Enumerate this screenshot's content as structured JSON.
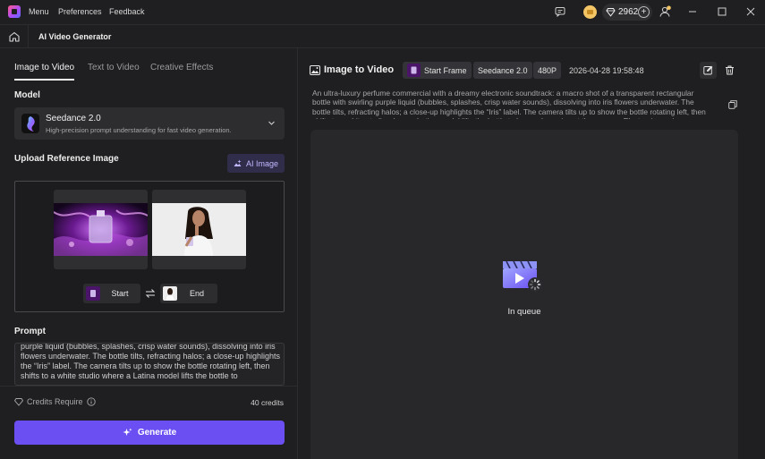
{
  "titlebar": {
    "menu": [
      "Menu",
      "Preferences",
      "Feedback"
    ],
    "credits": "2962",
    "plus": "+"
  },
  "navbar": {
    "title": "AI Video Generator"
  },
  "left": {
    "tabs": [
      "Image to Video",
      "Text to Video",
      "Creative Effects"
    ],
    "model_label": "Model",
    "model_name": "Seedance 2.0",
    "model_desc": "High-precision prompt understanding for fast video generation.",
    "upload_label": "Upload Reference Image",
    "ai_image_label": "AI Image",
    "start_label": "Start",
    "end_label": "End",
    "prompt_label": "Prompt",
    "prompt_text": "purple liquid (bubbles, splashes, crisp water sounds), dissolving into iris flowers underwater. The bottle tilts, refracting halos; a close-up highlights the “Iris” label. The camera tilts up to show the bottle rotating left, then shifts to a white studio where a Latina model lifts the bottle to",
    "credits_require_label": "Credits Require",
    "credits_value": "40 credits",
    "generate_label": "Generate"
  },
  "right": {
    "title": "Image to Video",
    "chip_frame": "Start Frame",
    "chip_model": "Seedance 2.0",
    "chip_res": "480P",
    "timestamp": "2026-04-28 19:58:48",
    "description": "An ultra-luxury perfume commercial with a dreamy electronic soundtrack: a macro shot of a transparent rectangular bottle with swirling purple liquid (bubbles, splashes, crisp water sounds), dissolving into iris flowers underwater. The bottle tilts, refracting halos; a close-up highlights the “Iris” label. The camera tilts up to show the bottle rotating left, then shifts to a white studio where a Latina model lifts the bottle to her neck, gazing at the camera. Electronic music",
    "status": "In queue"
  },
  "colors": {
    "accent": "#6b4ff2",
    "background": "#1f1f21",
    "panel": "#2d2d30"
  }
}
